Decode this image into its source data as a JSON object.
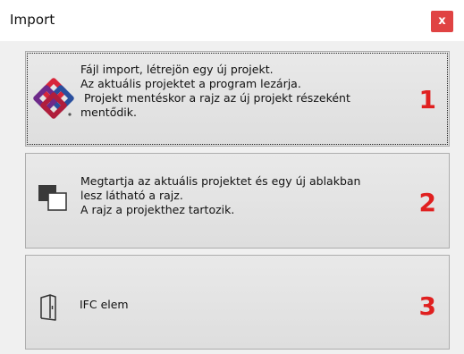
{
  "dialog": {
    "title": "Import",
    "close_label": "x"
  },
  "options": [
    {
      "icon": "ifc-logo-icon",
      "description": "Fájl import, létrejön egy új projekt.\nAz aktuális projektet a program lezárja.\n Projekt mentéskor a rajz az új projekt részeként\nmentődik.",
      "number": "1"
    },
    {
      "icon": "new-window-icon",
      "description": "Megtartja az aktuális projektet és egy új ablakban\nlesz látható a rajz.\nA rajz a projekthez tartozik.",
      "number": "2"
    },
    {
      "icon": "door-element-icon",
      "description": "IFC elem",
      "number": "3"
    }
  ],
  "colors": {
    "close_button": "#e04343",
    "number_accent": "#e02020",
    "ifc_red": "#d8263a",
    "ifc_blue": "#2a4f9e",
    "ifc_purple": "#6d2a8a"
  }
}
